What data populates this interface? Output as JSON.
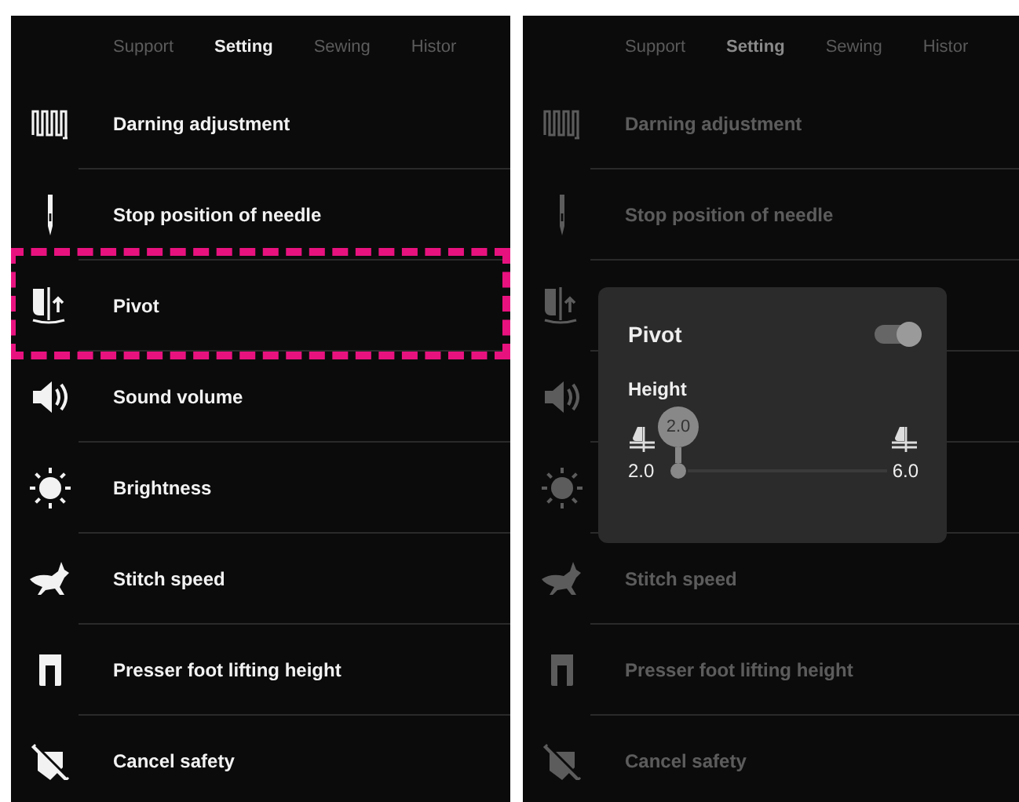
{
  "screens": [
    {
      "dimmed": false,
      "tabs": [
        {
          "label": "Support",
          "selected": false
        },
        {
          "label": "Setting",
          "selected": true
        },
        {
          "label": "Sewing",
          "selected": false
        },
        {
          "label": "Histor",
          "selected": false
        }
      ],
      "settings": [
        {
          "kind": "darning",
          "label": "Darning adjustment",
          "highlighted": false
        },
        {
          "kind": "needle",
          "label": "Stop position of needle",
          "highlighted": false
        },
        {
          "kind": "pivot",
          "label": "Pivot",
          "highlighted": true
        },
        {
          "kind": "volume",
          "label": "Sound volume",
          "highlighted": false
        },
        {
          "kind": "brightness",
          "label": "Brightness",
          "highlighted": false
        },
        {
          "kind": "speed",
          "label": "Stitch speed",
          "highlighted": false
        },
        {
          "kind": "presser",
          "label": "Presser foot lifting height",
          "highlighted": false
        },
        {
          "kind": "safety",
          "label": "Cancel safety",
          "highlighted": false
        }
      ]
    },
    {
      "dimmed": true,
      "tabs": [
        {
          "label": "Support",
          "selected": false
        },
        {
          "label": "Setting",
          "selected": true
        },
        {
          "label": "Sewing",
          "selected": false
        },
        {
          "label": "Histor",
          "selected": false
        }
      ],
      "settings": [
        {
          "kind": "darning",
          "label": "Darning adjustment"
        },
        {
          "kind": "needle",
          "label": "Stop position of needle"
        },
        {
          "kind": "pivot"
        },
        {
          "kind": "volume"
        },
        {
          "kind": "brightness"
        },
        {
          "kind": "speed",
          "label": "Stitch speed"
        },
        {
          "kind": "presser",
          "label": "Presser foot lifting height"
        },
        {
          "kind": "safety",
          "label": "Cancel safety"
        }
      ],
      "popup": {
        "title": "Pivot",
        "on": true,
        "label": "Height",
        "bubble": "2.0",
        "min": "2.0",
        "max": "6.0"
      }
    }
  ]
}
